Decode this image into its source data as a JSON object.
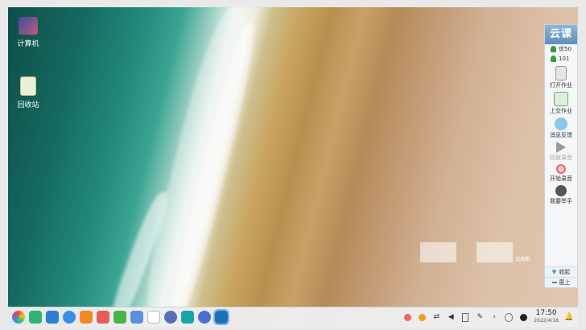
{
  "desktop": {
    "icons": [
      {
        "label": "计算机"
      },
      {
        "label": "回收站"
      }
    ],
    "watermark_text": "试用期"
  },
  "panel": {
    "logo": "云课",
    "stat_1": "优50",
    "stat_2": "101",
    "tools": [
      {
        "label": "打开作业"
      },
      {
        "label": "上交作业"
      },
      {
        "label": "消息反馈"
      },
      {
        "label": "回放录音"
      },
      {
        "label": "开始录音"
      },
      {
        "label": "我要举手"
      }
    ],
    "collapse_label": "收起",
    "minimize_label": "匿上"
  },
  "taskbar": {
    "time": "17:50",
    "date": "2022/4/18"
  }
}
